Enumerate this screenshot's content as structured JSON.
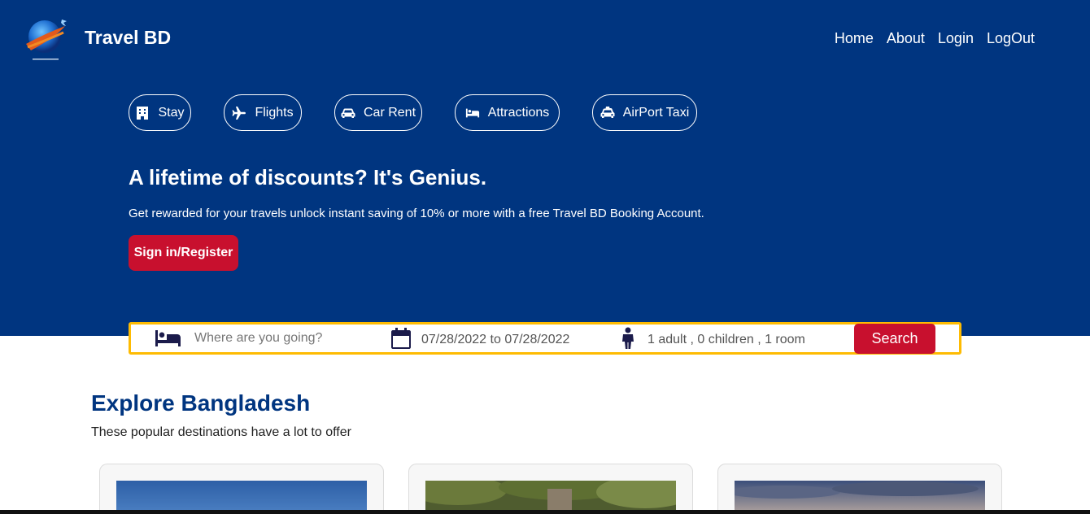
{
  "header": {
    "brand": "Travel BD",
    "nav": [
      "Home",
      "About",
      "Login",
      "LogOut"
    ]
  },
  "categories": [
    {
      "label": "Stay",
      "icon": "building-icon"
    },
    {
      "label": "Flights",
      "icon": "plane-icon"
    },
    {
      "label": "Car Rent",
      "icon": "car-icon"
    },
    {
      "label": "Attractions",
      "icon": "bed-icon"
    },
    {
      "label": "AirPort Taxi",
      "icon": "taxi-icon"
    }
  ],
  "hero": {
    "headline": "A lifetime of discounts? It's Genius.",
    "subline": "Get rewarded for your travels unlock instant saving of 10% or more with a free Travel BD Booking Account.",
    "signin_label": "Sign in/Register"
  },
  "search": {
    "destination_placeholder": "Where are you going?",
    "dates": "07/28/2022 to 07/28/2022",
    "guests": "1 adult , 0 children , 1 room",
    "button_label": "Search"
  },
  "explore": {
    "title": "Explore Bangladesh",
    "subtitle": "These popular destinations have a lot to offer"
  },
  "colors": {
    "primary": "#003580",
    "accent": "#c8102e",
    "search_border": "#febb02"
  }
}
